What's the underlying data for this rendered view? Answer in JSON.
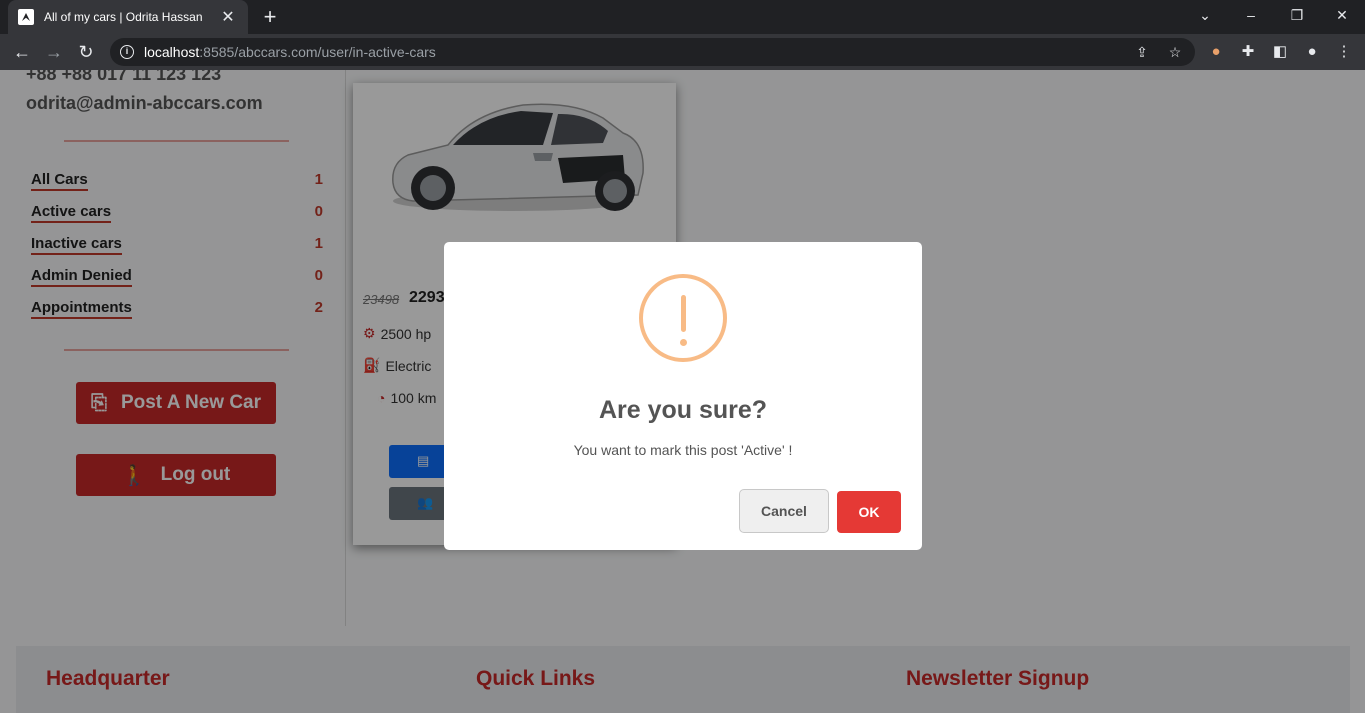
{
  "browser": {
    "tab_title": "All of my cars | Odrita Hassan",
    "url_host": "localhost",
    "url_rest": ":8585/abccars.com/user/in-active-cars"
  },
  "sidebar": {
    "phone": "+88 +88 017 11 123 123",
    "email": "odrita@admin-abccars.com",
    "items": [
      {
        "label": "All Cars",
        "count": "1"
      },
      {
        "label": "Active cars",
        "count": "0"
      },
      {
        "label": "Inactive cars",
        "count": "1"
      },
      {
        "label": "Admin Denied",
        "count": "0"
      },
      {
        "label": "Appointments",
        "count": "2"
      }
    ],
    "post_button": "Post A New Car",
    "logout_button": "Log out"
  },
  "card": {
    "old_price": "23498",
    "new_price": "2293",
    "power": "2500 hp",
    "fuel": "Electric",
    "mileage": "100 km",
    "button_colors": [
      "#0d6efd",
      "#6c757d"
    ]
  },
  "footer": {
    "headings": [
      "Headquarter",
      "Quick Links",
      "Newsletter Signup"
    ]
  },
  "dialog": {
    "title": "Are you sure?",
    "text": "You want to mark this post 'Active' !",
    "cancel_label": "Cancel",
    "ok_label": "OK",
    "icon": "warning-icon",
    "icon_color": "#f8bb86",
    "ok_color": "#e53935"
  }
}
